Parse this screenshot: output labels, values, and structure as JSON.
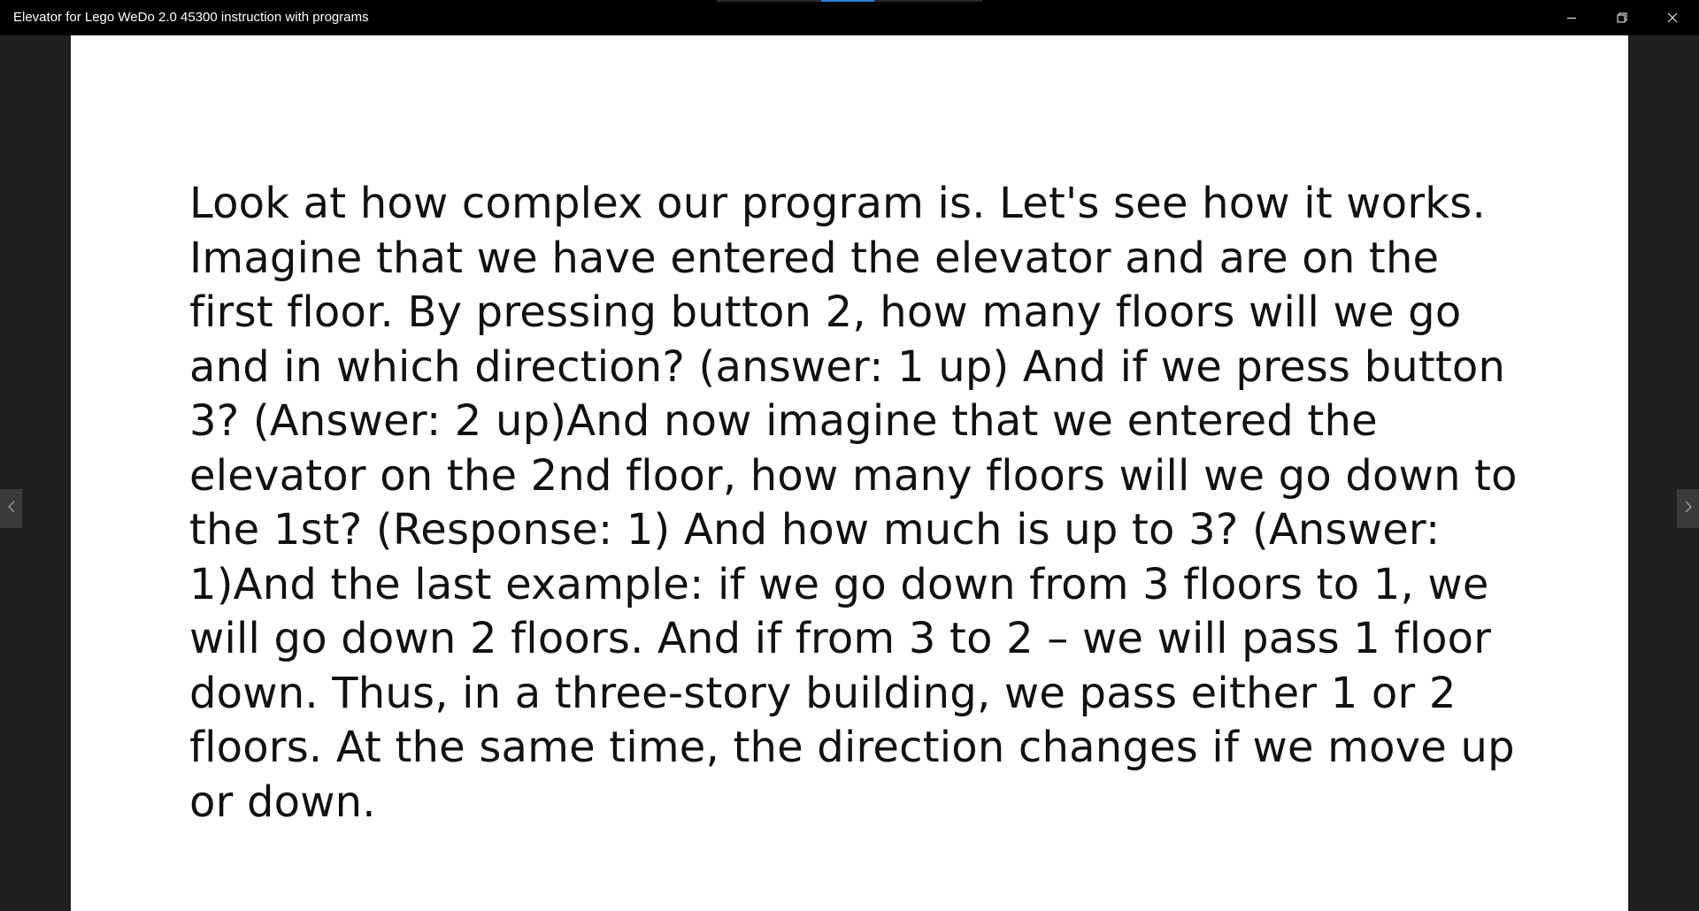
{
  "window": {
    "title": "Elevator for Lego WeDo 2.0 45300 instruction with programs",
    "controls": {
      "minimize_icon": "minimize-icon",
      "maximize_icon": "restore-icon",
      "close_icon": "close-icon"
    },
    "loading_progress": 0.4
  },
  "page": {
    "text": "Look at how complex our program is. Let's see how it works. Imagine that we have entered the elevator and are on the first floor. By pressing button 2, how many floors will we go and in which direction? (answer: 1 up) And if we press button 3? (Answer: 2 up)And now imagine that we entered the elevator on the 2nd floor, how many floors will we go down to the 1st? (Response: 1) And how much is up to 3? (Answer: 1)And the last example: if we go down from 3 floors to 1, we will go down 2 floors. And if from 3 to 2 – we will pass 1 floor down. Thus, in a three-story building, we pass either 1 or 2 floors. At the same time, the direction changes if we move up or down."
  },
  "navigation": {
    "prev_icon": "chevron-left-icon",
    "next_icon": "chevron-right-icon"
  },
  "colors": {
    "titlebar": "#000000",
    "background": "#1f1f1f",
    "page": "#ffffff",
    "accent": "#2f7bd6"
  }
}
